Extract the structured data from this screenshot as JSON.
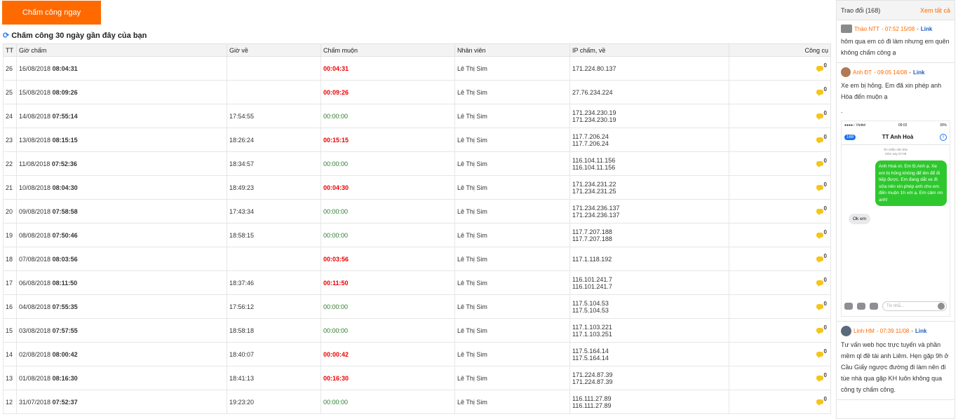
{
  "checkin_button": "Chấm công ngay",
  "section_title": "Chấm công 30 ngày gần đây của bạn",
  "columns": [
    "TT",
    "Giờ chấm",
    "Giờ về",
    "Chấm muộn",
    "Nhân viên",
    "IP chấm, về",
    "Công cụ"
  ],
  "rows": [
    {
      "tt": "26",
      "date": "16/08/2018",
      "time_in": "08:04:31",
      "time_out": "",
      "late": "00:04:31",
      "is_late": true,
      "employee": "Lê Thị Sim",
      "ip1": "171.224.80.137",
      "ip2": "",
      "comments": "0"
    },
    {
      "tt": "25",
      "date": "15/08/2018",
      "time_in": "08:09:26",
      "time_out": "",
      "late": "00:09:26",
      "is_late": true,
      "employee": "Lê Thị Sim",
      "ip1": "27.76.234.224",
      "ip2": "",
      "comments": "0"
    },
    {
      "tt": "24",
      "date": "14/08/2018",
      "time_in": "07:55:14",
      "time_out": "17:54:55",
      "late": "00:00:00",
      "is_late": false,
      "employee": "Lê Thị Sim",
      "ip1": "171.234.230.19",
      "ip2": "171.234.230.19",
      "comments": "0"
    },
    {
      "tt": "23",
      "date": "13/08/2018",
      "time_in": "08:15:15",
      "time_out": "18:26:24",
      "late": "00:15:15",
      "is_late": true,
      "employee": "Lê Thị Sim",
      "ip1": "117.7.206.24",
      "ip2": "117.7.206.24",
      "comments": "0"
    },
    {
      "tt": "22",
      "date": "11/08/2018",
      "time_in": "07:52:36",
      "time_out": "18:34:57",
      "late": "00:00:00",
      "is_late": false,
      "employee": "Lê Thị Sim",
      "ip1": "116.104.11.156",
      "ip2": "116.104.11.156",
      "comments": "0"
    },
    {
      "tt": "21",
      "date": "10/08/2018",
      "time_in": "08:04:30",
      "time_out": "18:49:23",
      "late": "00:04:30",
      "is_late": true,
      "employee": "Lê Thị Sim",
      "ip1": "171.234.231.22",
      "ip2": "171.234.231.25",
      "comments": "0"
    },
    {
      "tt": "20",
      "date": "09/08/2018",
      "time_in": "07:58:58",
      "time_out": "17:43:34",
      "late": "00:00:00",
      "is_late": false,
      "employee": "Lê Thị Sim",
      "ip1": "171.234.236.137",
      "ip2": "171.234.236.137",
      "comments": "0"
    },
    {
      "tt": "19",
      "date": "08/08/2018",
      "time_in": "07:50:46",
      "time_out": "18:58:15",
      "late": "00:00:00",
      "is_late": false,
      "employee": "Lê Thị Sim",
      "ip1": "117.7.207.188",
      "ip2": "117.7.207.188",
      "comments": "0"
    },
    {
      "tt": "18",
      "date": "07/08/2018",
      "time_in": "08:03:56",
      "time_out": "",
      "late": "00:03:56",
      "is_late": true,
      "employee": "Lê Thị Sim",
      "ip1": "117.1.118.192",
      "ip2": "",
      "comments": "0"
    },
    {
      "tt": "17",
      "date": "06/08/2018",
      "time_in": "08:11:50",
      "time_out": "18:37:46",
      "late": "00:11:50",
      "is_late": true,
      "employee": "Lê Thị Sim",
      "ip1": "116.101.241.7",
      "ip2": "116.101.241.7",
      "comments": "0"
    },
    {
      "tt": "16",
      "date": "04/08/2018",
      "time_in": "07:55:35",
      "time_out": "17:56:12",
      "late": "00:00:00",
      "is_late": false,
      "employee": "Lê Thị Sim",
      "ip1": "117.5.104.53",
      "ip2": "117.5.104.53",
      "comments": "0"
    },
    {
      "tt": "15",
      "date": "03/08/2018",
      "time_in": "07:57:55",
      "time_out": "18:58:18",
      "late": "00:00:00",
      "is_late": false,
      "employee": "Lê Thị Sim",
      "ip1": "117.1.103.221",
      "ip2": "117.1.103.251",
      "comments": "0"
    },
    {
      "tt": "14",
      "date": "02/08/2018",
      "time_in": "08:00:42",
      "time_out": "18:40:07",
      "late": "00:00:42",
      "is_late": true,
      "employee": "Lê Thị Sim",
      "ip1": "117.5.164.14",
      "ip2": "117.5.164.14",
      "comments": "0"
    },
    {
      "tt": "13",
      "date": "01/08/2018",
      "time_in": "08:16:30",
      "time_out": "18:41:13",
      "late": "00:16:30",
      "is_late": true,
      "employee": "Lê Thị Sim",
      "ip1": "171.224.87.39",
      "ip2": "171.224.87.39",
      "comments": "0"
    },
    {
      "tt": "12",
      "date": "31/07/2018",
      "time_in": "07:52:37",
      "time_out": "19:23:20",
      "late": "00:00:00",
      "is_late": false,
      "employee": "Lê Thị Sim",
      "ip1": "116.111.27.89",
      "ip2": "116.111.27.89",
      "comments": "0"
    }
  ],
  "panel": {
    "title": "Trao đổi (168)",
    "see_all": "Xem tất cả",
    "messages": [
      {
        "name": "Thảo NTT",
        "time": " - 07:52 15/08",
        "link": "Link",
        "text": "hôm qua em có đi làm nhưng em quên không chấm công ạ"
      },
      {
        "name": "Anh ĐT",
        "time": " - 09:05 14/08",
        "link": "Link",
        "text": "Xe em bị hỏng. Em đã xin phép anh Hòa đến muộn ạ"
      },
      {
        "name": "Linh HM",
        "time": " - 07:39 11/08",
        "link": "Link",
        "text": "Tư vấn web học trực tuyến và phần mềm ql đề tài anh Liêm. Hẹn gặp 9h ở Cầu Giấy ngược đường đi làm nên đi tùe nhà qua gặp KH luôn không qua công ty chấm công."
      }
    ],
    "phone": {
      "carrier": "●●●●○ Viettel",
      "clock": "09:02",
      "battery": "30%",
      "back_badge": "169",
      "contact": "TT Anh Hoà",
      "sub_line1": "Tin nhắn văn bản",
      "sub_line2": "Hôm nay 07:08",
      "sent": "Anh Hoà ơi. Em Đ.Anh ạ. Xe em bị hỏng không để lên để đi tiếp được. Em đang dắt xe đi sửa nên xin phép anh cho em đến muộn 1h với ạ. Em cảm ơn anh!",
      "received": "Ok em",
      "input_placeholder": "Tin nhắ..."
    }
  }
}
